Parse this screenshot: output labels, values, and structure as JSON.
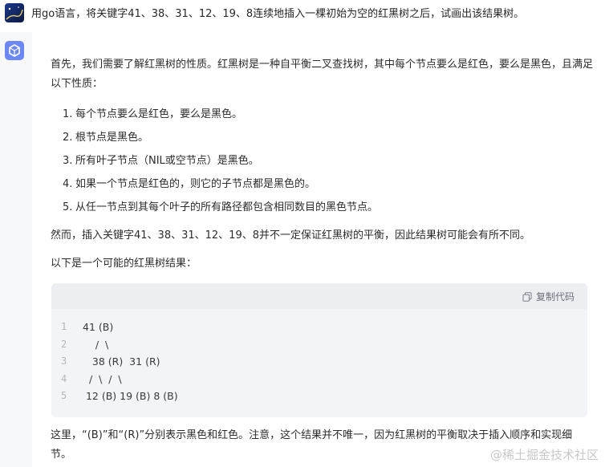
{
  "user_message": {
    "text": "用go语言，将关键字41、38、31、12、19、8连续地插入一棵初始为空的红黑树之后，试画出该结果树。"
  },
  "response": {
    "intro": "首先，我们需要了解红黑树的性质。红黑树是一种自平衡二叉查找树，其中每个节点要么是红色，要么是黑色，且满足以下性质：",
    "properties": [
      {
        "num": "1.",
        "text": "每个节点要么是红色，要么是黑色。"
      },
      {
        "num": "2.",
        "text": "根节点是黑色。"
      },
      {
        "num": "3.",
        "text": "所有叶子节点（NIL或空节点）是黑色。"
      },
      {
        "num": "4.",
        "text": "如果一个节点是红色的，则它的子节点都是黑色的。"
      },
      {
        "num": "5.",
        "text": "从任一节点到其每个叶子的所有路径都包含相同数目的黑色节点。"
      }
    ],
    "however": "然而，插入关键字41、38、31、12、19、8并不一定保证红黑树的平衡，因此结果树可能会有所不同。",
    "lead_in": "以下是一个可能的红黑树结果：",
    "code": {
      "copy_label": "复制代码",
      "lines": [
        {
          "n": "1",
          "text": "41 (B)"
        },
        {
          "n": "2",
          "text": "    /  \\"
        },
        {
          "n": "3",
          "text": "   38 (R)  31 (R)"
        },
        {
          "n": "4",
          "text": "  /  \\  /  \\"
        },
        {
          "n": "5",
          "text": " 12 (B) 19 (B) 8 (B)"
        }
      ]
    },
    "closing": "这里，“(B)”和“(R)”分别表示黑色和红色。注意，这个结果并不唯一，因为红黑树的平衡取决于插入顺序和实现细节。"
  },
  "watermark": "@稀土掘金技术社区",
  "colors": {
    "bot_avatar": "#6c87f7",
    "code_bg": "#f3f4f7",
    "page_gray": "#f7f8fa"
  }
}
